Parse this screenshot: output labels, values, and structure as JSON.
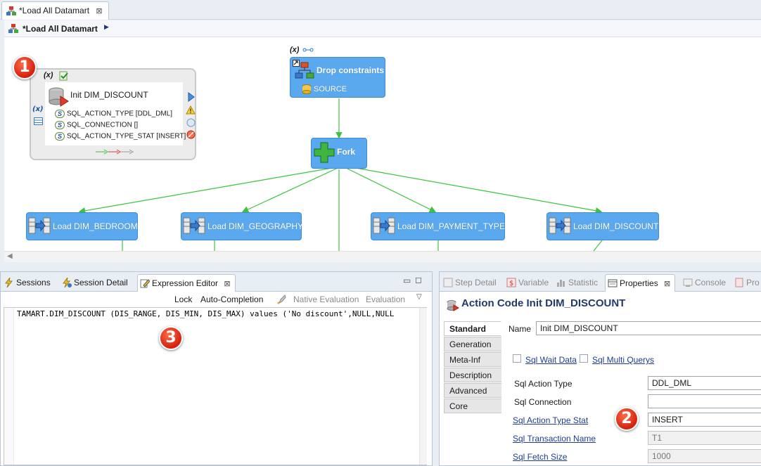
{
  "editor_tab": {
    "title": "*Load All Datamart",
    "close": "⊠"
  },
  "diagram": {
    "title": "*Load All Datamart",
    "init_block": {
      "var_marker": "(x)",
      "title": "Init DIM_DISCOUNT",
      "params": [
        "SQL_ACTION_TYPE [DDL_DML]",
        "SQL_CONNECTION []",
        "SQL_ACTION_TYPE_STAT [INSERT]"
      ]
    },
    "drop_node": {
      "var_marker": "(x)",
      "label": "Drop constraints",
      "sub_label": "SOURCE"
    },
    "fork_node": {
      "label": "Fork"
    },
    "load_nodes": [
      "Load DIM_BEDROOM",
      "Load DIM_GEOGRAPHY",
      "Load DIM_PAYMENT_TYPE",
      "Load DIM_DISCOUNT"
    ],
    "link_color": "#3cc43c",
    "node_color": "#5aa9ef"
  },
  "badges": [
    "1",
    "2",
    "3"
  ],
  "left_panel": {
    "tabs": [
      "Sessions",
      "Session Detail",
      "Expression Editor"
    ],
    "active_tab": "Expression Editor",
    "toolbar": {
      "lock": "Lock",
      "auto_completion": "Auto-Completion",
      "native_evaluation": "Native Evaluation",
      "evaluation": "Evaluation"
    },
    "code_line": "TAMART.DIM_DISCOUNT (DIS_RANGE, DIS_MIN, DIS_MAX) values ('No discount',NULL,NULL"
  },
  "right_panel": {
    "tabs": [
      "Step Detail",
      "Variable",
      "Statistic",
      "Properties",
      "Console",
      "Pro"
    ],
    "active_tab": "Properties",
    "title": "Action Code Init DIM_DISCOUNT",
    "side_tabs": [
      "Standard",
      "Generation",
      "Meta-Inf",
      "Description",
      "Advanced",
      "Core"
    ],
    "name_label": "Name",
    "name_value": "Init DIM_DISCOUNT",
    "checkboxes": [
      "Sql Wait Data",
      "Sql Multi Querys"
    ],
    "fields": [
      {
        "label": "Sql Action Type",
        "value": "DDL_DML",
        "link": false,
        "disabled": false
      },
      {
        "label": "Sql Connection",
        "value": "",
        "link": false,
        "disabled": false
      },
      {
        "label": "Sql Action Type Stat",
        "value": "INSERT",
        "link": true,
        "disabled": false
      },
      {
        "label": "Sql Transaction Name",
        "value": "T1",
        "link": true,
        "disabled": true
      },
      {
        "label": "Sql Fetch Size",
        "value": "1000",
        "link": true,
        "disabled": true
      }
    ]
  }
}
